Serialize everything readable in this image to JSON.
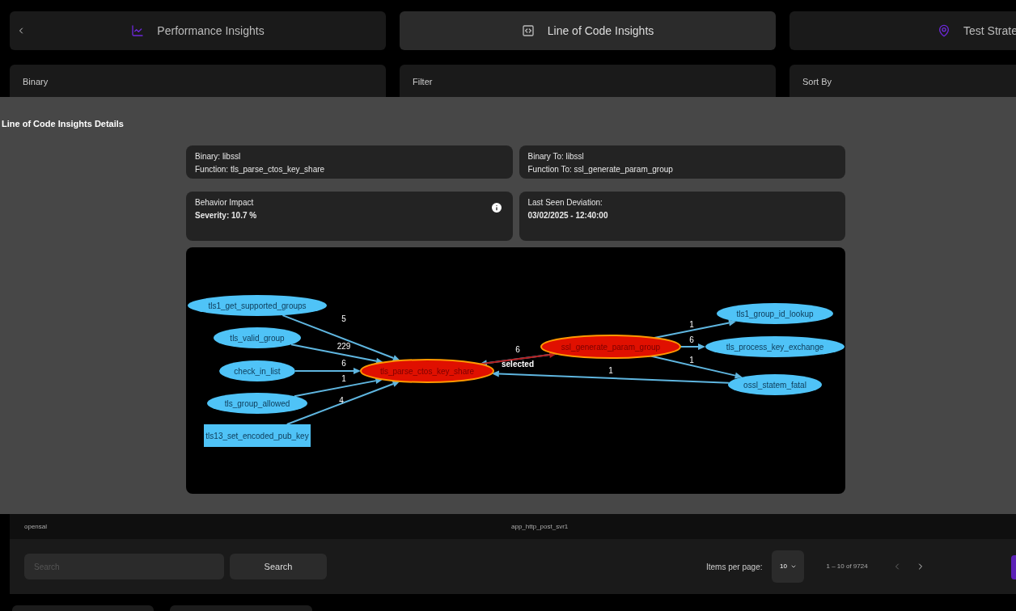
{
  "tabs": [
    {
      "label": "Performance Insights",
      "selected": false
    },
    {
      "label": "Line of Code Insights",
      "selected": true
    },
    {
      "label": "Test Strate",
      "selected": false
    }
  ],
  "filters": [
    {
      "label": "Binary"
    },
    {
      "label": "Filter"
    },
    {
      "label": "Sort By"
    }
  ],
  "modal": {
    "title": "Line of Code Insights Details",
    "cards": [
      {
        "lines": [
          "Binary: libssl",
          "Function: tls_parse_ctos_key_share"
        ]
      },
      {
        "lines": [
          "Binary To: libssl",
          "Function To: ssl_generate_param_group"
        ]
      },
      {
        "lines": [
          "Behavior Impact",
          "Severity: 10.7 %"
        ]
      },
      {
        "lines": [
          "Last Seen Deviation:",
          "03/02/2025 - 12:40:00"
        ]
      }
    ],
    "graph": {
      "nodes": [
        {
          "label": "tls1_get_supported_groups",
          "kind": "ellipse",
          "color": "#4fc3f7"
        },
        {
          "label": "tls_valid_group",
          "kind": "ellipse",
          "color": "#4fc3f7"
        },
        {
          "label": "check_in_list",
          "kind": "ellipse",
          "color": "#4fc3f7"
        },
        {
          "label": "tls_group_allowed",
          "kind": "ellipse",
          "color": "#4fc3f7"
        },
        {
          "label": "tls13_set_encoded_pub_key",
          "kind": "rect",
          "color": "#4fc3f7"
        },
        {
          "label": "tls_parse_ctos_key_share",
          "kind": "ellipse",
          "color": "#e01000"
        },
        {
          "label": "ssl_generate_param_group",
          "kind": "ellipse",
          "color": "#e01000"
        },
        {
          "label": "tls1_group_id_lookup",
          "kind": "ellipse",
          "color": "#4fc3f7"
        },
        {
          "label": "tls_process_key_exchange",
          "kind": "ellipse",
          "color": "#4fc3f7"
        },
        {
          "label": "ossl_statem_fatal",
          "kind": "ellipse",
          "color": "#4fc3f7"
        }
      ],
      "edges": [
        {
          "label": "5",
          "selected": false
        },
        {
          "label": "229",
          "selected": false
        },
        {
          "label": "6",
          "selected": false
        },
        {
          "label": "1",
          "selected": false
        },
        {
          "label": "4",
          "selected": false
        },
        {
          "label": "6",
          "selected": false
        },
        {
          "label": "selected",
          "selected": true
        },
        {
          "label": "1",
          "selected": false
        },
        {
          "label": "1",
          "selected": false
        },
        {
          "label": "6",
          "selected": false
        },
        {
          "label": "1",
          "selected": false
        }
      ]
    }
  },
  "row": [
    "opensal",
    "app_http_post_svr1"
  ],
  "pagination": {
    "search_placeholder": "Search",
    "search_button": "Search",
    "items_label": "Items per page:",
    "page_size": "10",
    "range": "1 – 10 of 9724"
  }
}
